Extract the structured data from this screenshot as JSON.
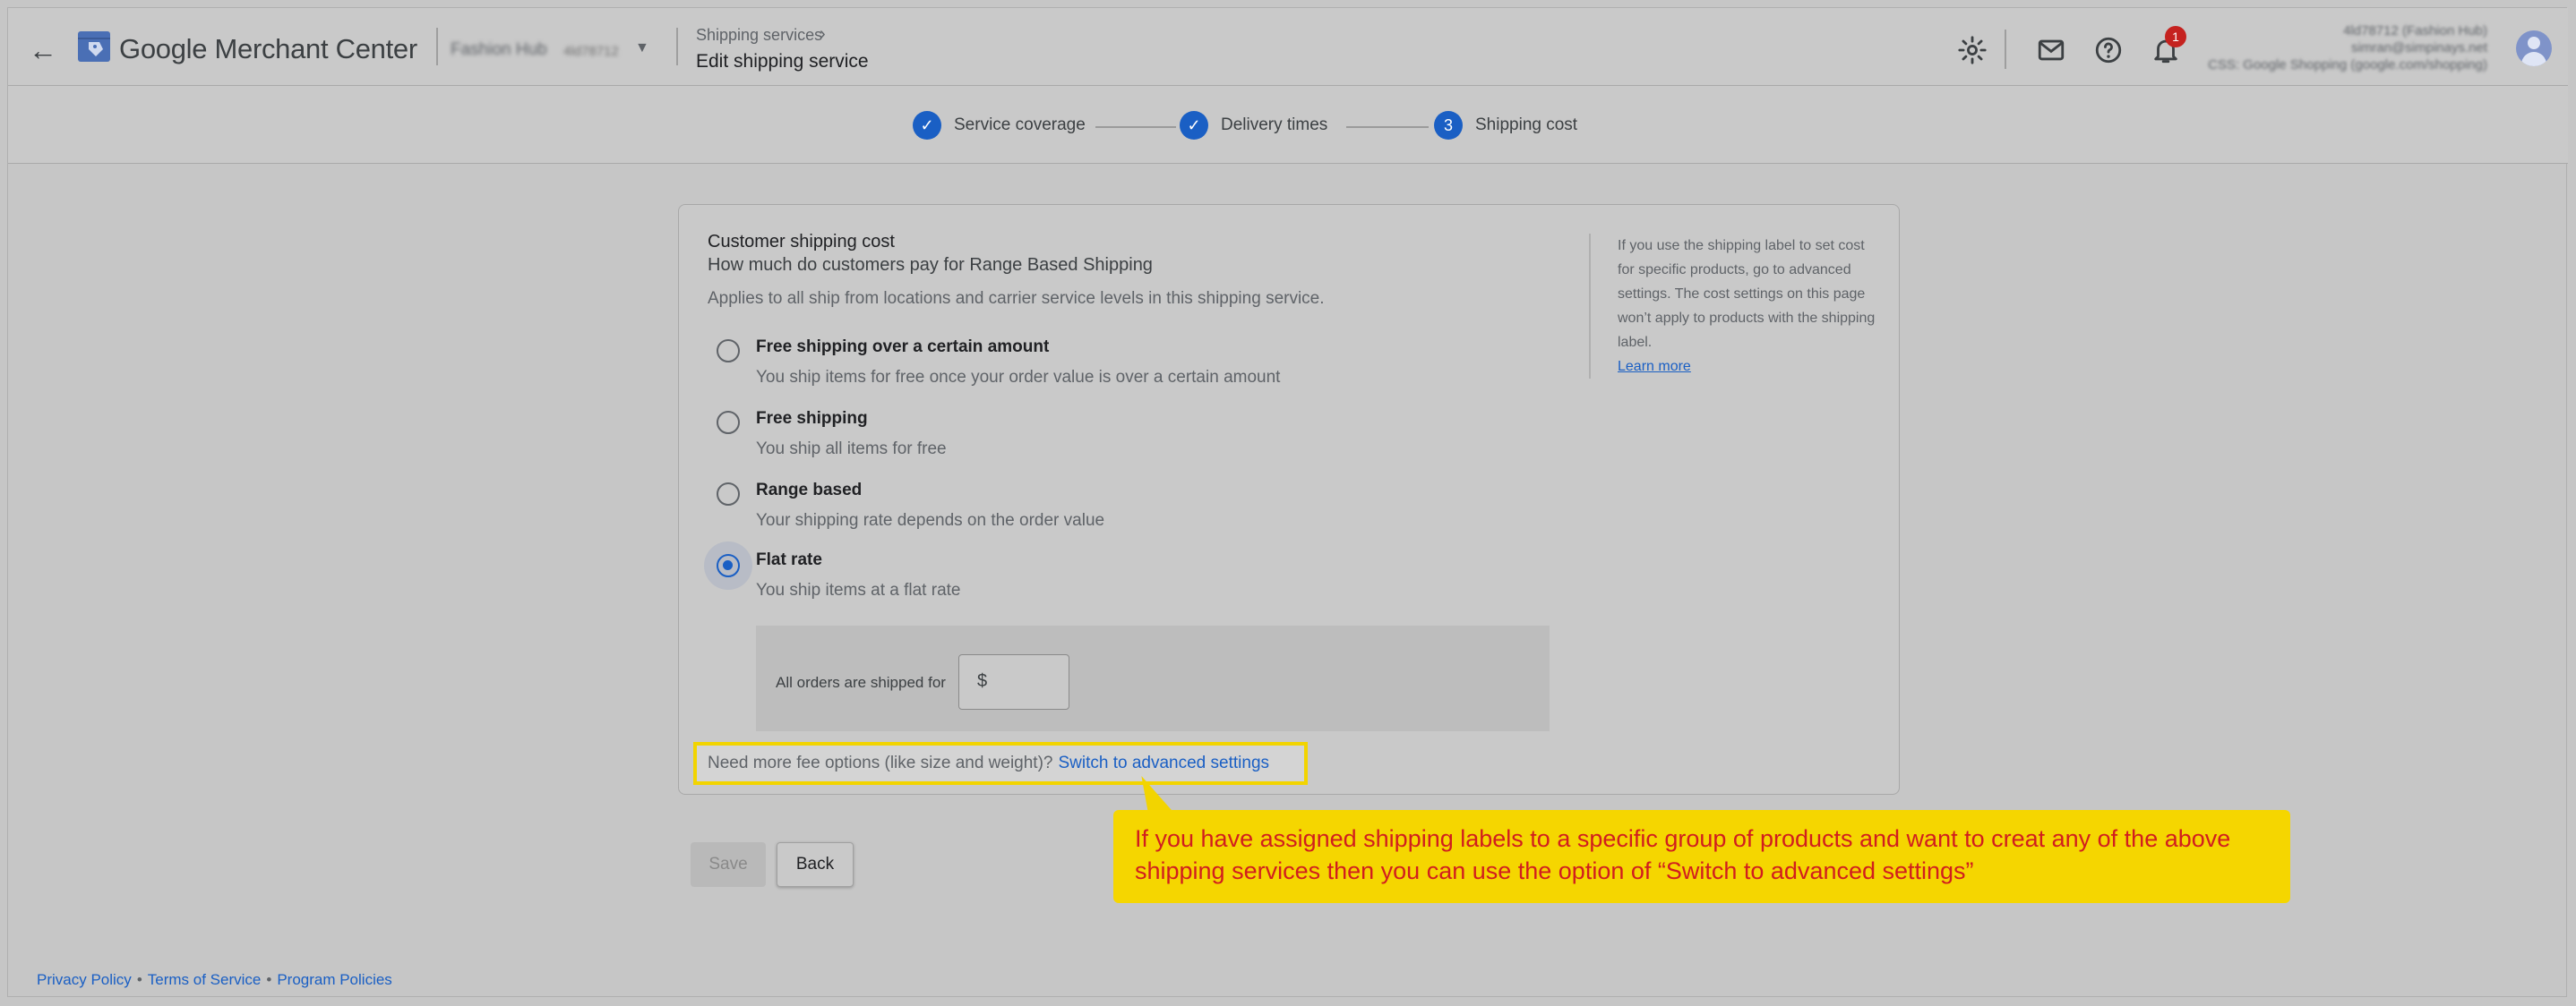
{
  "header": {
    "brand": "Google Merchant Center",
    "account_name": "Fashion Hub",
    "account_id": "4ld78712",
    "breadcrumb": "Shipping services",
    "page_title": "Edit shipping service",
    "notification_count": "1",
    "user": {
      "line1": "4ld78712 (Fashion Hub)",
      "line2": "simran@simpinays.net",
      "line3": "CSS: Google Shopping (google.com/shopping)"
    }
  },
  "stepper": {
    "steps": [
      {
        "label": "Service coverage",
        "state": "done"
      },
      {
        "label": "Delivery times",
        "state": "done"
      },
      {
        "label": "Shipping cost",
        "state": "current",
        "number": "3"
      }
    ]
  },
  "card": {
    "title": "Customer shipping cost",
    "subtitle": "How much do customers pay for Range Based Shipping",
    "applies": "Applies to all ship from locations and carrier service levels in this shipping service.",
    "options": [
      {
        "label": "Free shipping over a certain amount",
        "desc": "You ship items for free once your order value is over a certain amount",
        "selected": false
      },
      {
        "label": "Free shipping",
        "desc": "You ship all items for free",
        "selected": false
      },
      {
        "label": "Range based",
        "desc": "Your shipping rate depends on the order value",
        "selected": false
      },
      {
        "label": "Flat rate",
        "desc": "You ship items at a flat rate",
        "selected": true
      }
    ],
    "flat_rate_label": "All orders are shipped for",
    "flat_rate_prefix": "$",
    "flat_rate_value": "",
    "side_note": "If you use the shipping label to set cost for specific products, go to advanced settings. The cost settings on this page won’t apply to products with the shipping label.",
    "learn_more": "Learn more",
    "need_more_text": "Need more fee options (like size and weight)?",
    "need_more_link": "Switch to advanced settings"
  },
  "buttons": {
    "save": "Save",
    "back": "Back"
  },
  "callout": {
    "text": "If you have assigned shipping labels to a specific group of products and want to creat any of the above shipping services then you can use the option of “Switch to advanced settings”"
  },
  "footer": {
    "privacy": "Privacy Policy",
    "terms": "Terms of Service",
    "policies": "Program Policies"
  },
  "colors": {
    "accent": "#1a5fc4",
    "highlight": "#f5d600",
    "callout_text": "#d11e1e",
    "badge": "#c5221f"
  }
}
